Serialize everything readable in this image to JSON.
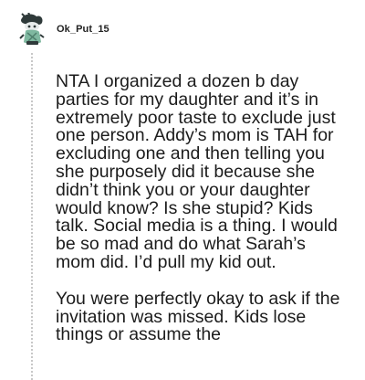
{
  "comment": {
    "username": "Ok_Put_15",
    "avatar_icon": "snoo-avatar-icon",
    "paragraphs": [
      "NTA I organized a dozen b day parties for my daughter and it’s in extremely poor taste to exclude just one person. Addy’s mom is TAH for excluding one and then telling you she purposely did it because she didn’t think you or your daughter would know? Is she stupid? Kids talk. Social media is a thing. I would be so mad and do what Sarah’s mom did. I’d pull my kid out.",
      "You were perfectly okay to ask if the invitation was missed. Kids lose things or assume the"
    ]
  },
  "colors": {
    "thread_line": "#c8c8c8",
    "avatar_dark": "#2f3a3a",
    "avatar_green": "#7fb8a0",
    "text": "#1c1c1c"
  }
}
